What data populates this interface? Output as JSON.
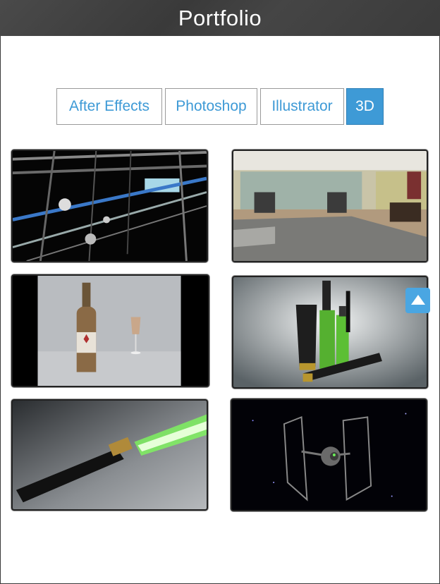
{
  "header": {
    "title": "Portfolio"
  },
  "tabs": [
    {
      "label": "After Effects",
      "active": false
    },
    {
      "label": "Photoshop",
      "active": false
    },
    {
      "label": "Illustrator",
      "active": false
    },
    {
      "label": "3D",
      "active": true
    }
  ],
  "colors": {
    "accent": "#3e9ad6",
    "header_bg": "#3f3f3f",
    "laser_green": "#6dff4a"
  },
  "gallery": {
    "items": [
      {
        "subject": "tunnel-render"
      },
      {
        "subject": "bedroom-interior-render"
      },
      {
        "subject": "bottle-and-glass-render"
      },
      {
        "subject": "cosmetics-products-render"
      },
      {
        "subject": "lightsaber-render"
      },
      {
        "subject": "tie-fighter-render"
      }
    ]
  },
  "scroll_top_button": {
    "icon": "triangle-up-icon"
  }
}
